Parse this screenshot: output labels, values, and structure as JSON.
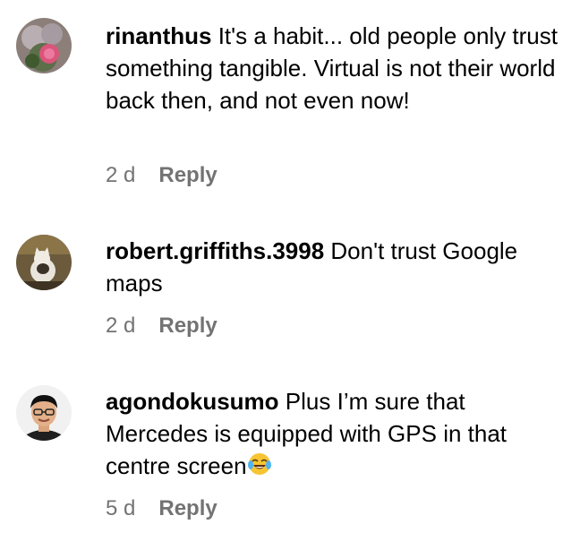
{
  "comments": [
    {
      "username": "rinanthus",
      "text": "It's a habit... old people only trust something tangible. Virtual is not their world back then, and not even now!",
      "time": "2 d",
      "reply_label": "Reply",
      "avatar_icon": "flower-avatar"
    },
    {
      "username": "robert.griffiths.3998",
      "text": "Don't trust Google maps",
      "time": "2 d",
      "reply_label": "Reply",
      "avatar_icon": "cat-avatar"
    },
    {
      "username": "agondokusumo",
      "text": "Plus I’m sure that Mercedes is equipped with GPS in that centre screen",
      "emoji": "tears-of-joy-emoji",
      "time": "5 d",
      "reply_label": "Reply",
      "avatar_icon": "man-glasses-avatar"
    }
  ]
}
